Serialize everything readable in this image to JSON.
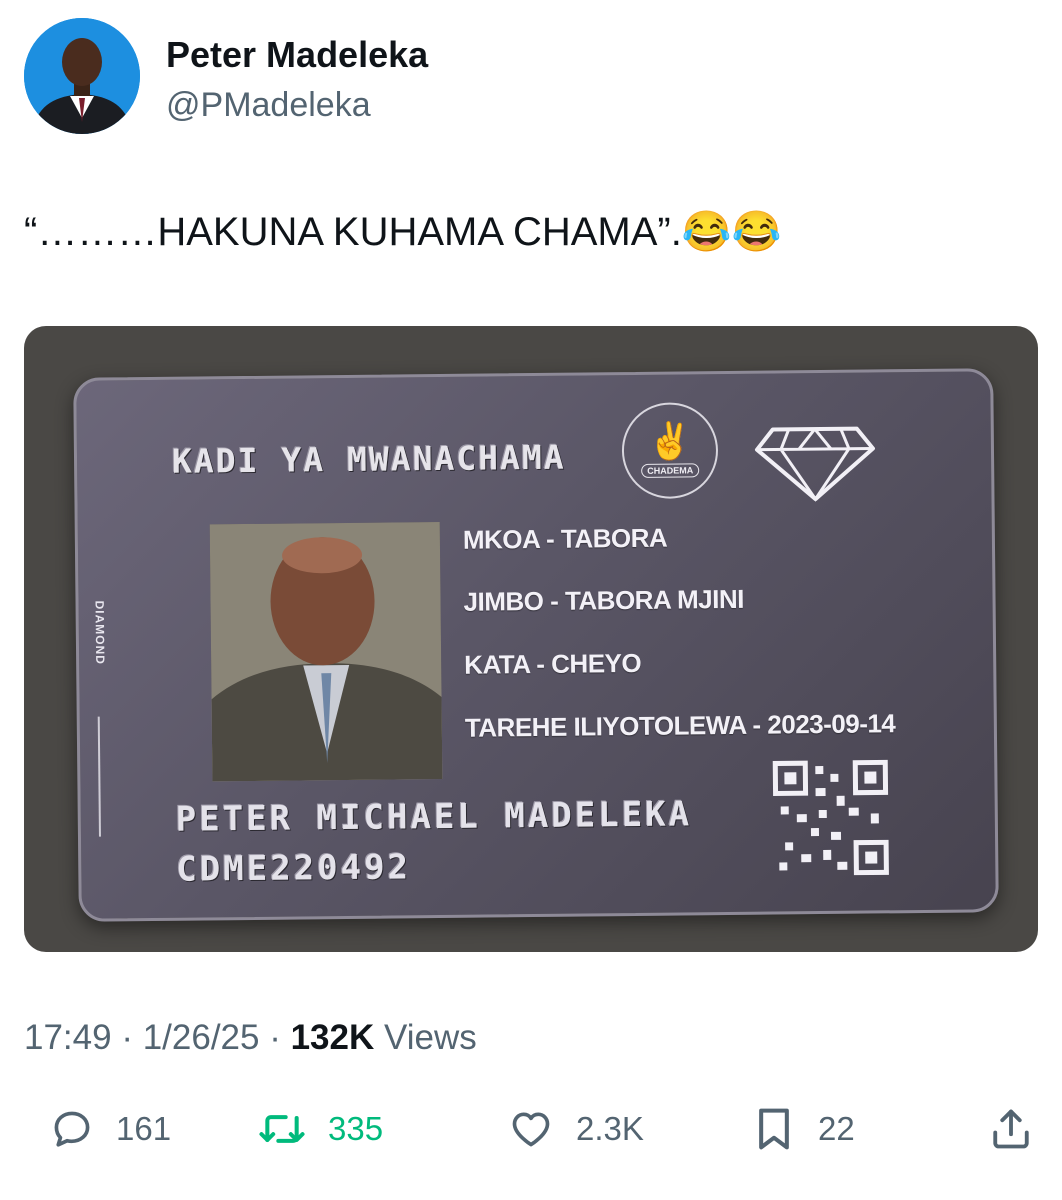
{
  "author": {
    "display_name": "Peter Madeleka",
    "handle": "@PMadeleka",
    "avatar_icon": "profile-photo"
  },
  "tweet": {
    "text": "“………HAKUNA KUHAMA CHAMA”.😂😂"
  },
  "media": {
    "card_title": "KADI YA MWANACHAMA",
    "logo_text": "CHADEMA",
    "side_label": "DIAMOND",
    "fields": [
      "MKOA - TABORA",
      "JIMBO - TABORA MJINI",
      "KATA - CHEYO",
      "TAREHE ILIYOTOLEWA - 2023-09-14"
    ],
    "member_name": "PETER MICHAEL MADELEKA",
    "member_number": "CDME220492"
  },
  "meta": {
    "time": "17:49",
    "separator": " · ",
    "date": "1/26/25",
    "views_count": "132K",
    "views_label": "Views"
  },
  "actions": {
    "replies": "161",
    "reposts": "335",
    "likes": "2.3K",
    "bookmarks": "22"
  },
  "colors": {
    "text_primary": "#0f1419",
    "text_secondary": "#536471",
    "repost_green": "#00ba7c",
    "avatar_bg": "#1d8fe0"
  }
}
